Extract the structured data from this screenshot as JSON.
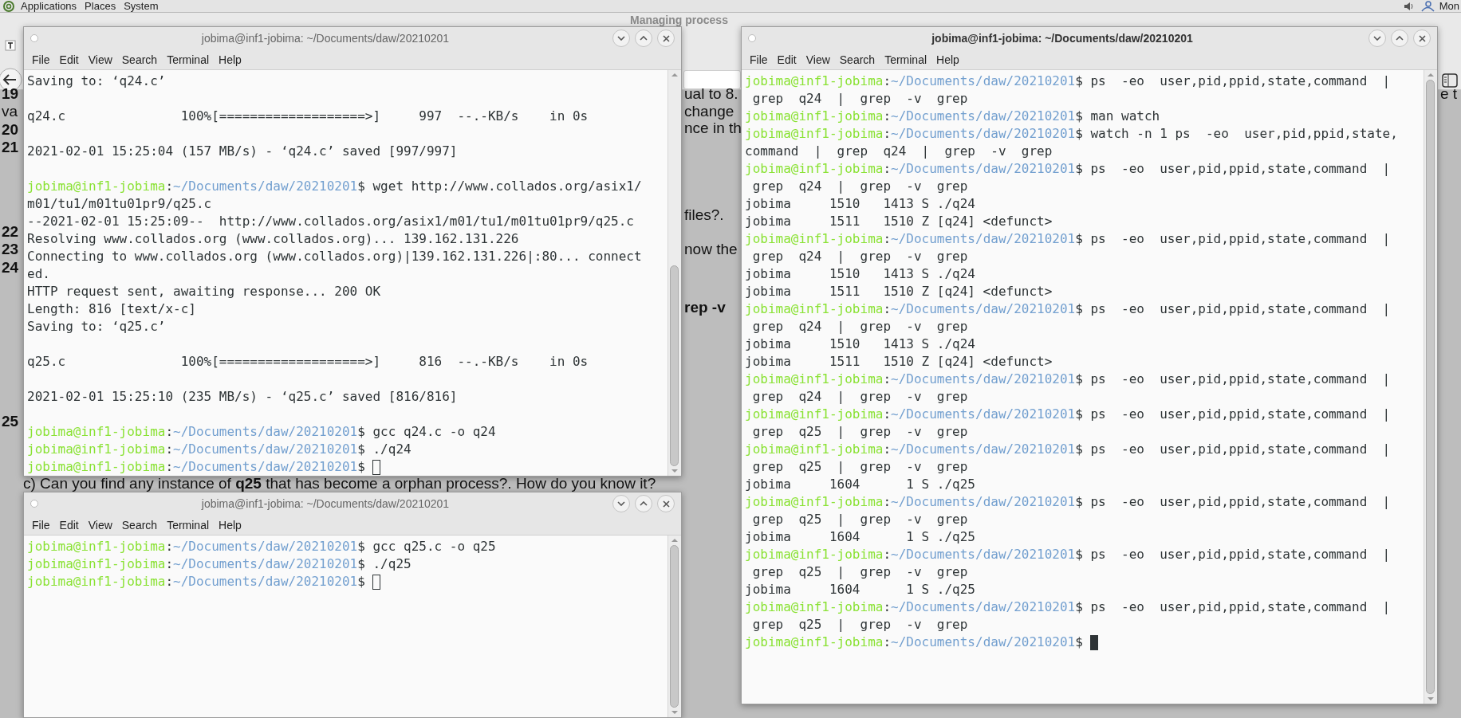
{
  "panel": {
    "menus": [
      "Applications",
      "Places",
      "System"
    ],
    "clock": "Mon"
  },
  "background_page": {
    "title": "Managing process",
    "fragments": [
      {
        "text": "19",
        "bold": true
      },
      {
        "text": "va",
        "bold": false
      },
      {
        "text": "20",
        "bold": true
      },
      {
        "text": "21",
        "bold": true
      },
      {
        "text": "22",
        "bold": true
      },
      {
        "text": "23",
        "bold": true
      },
      {
        "text": "24",
        "bold": true
      },
      {
        "text": "25",
        "bold": true
      },
      {
        "text": "ual to 8.",
        "bold": false
      },
      {
        "text": "change",
        "bold": false
      },
      {
        "text": "nce in th",
        "bold": false
      },
      {
        "text": "files?.",
        "bold": false
      },
      {
        "text": "now the",
        "bold": false
      },
      {
        "text": "rep  -v",
        "bold": true
      },
      {
        "text": "e t",
        "bold": false
      },
      {
        "text": "c) Can you find any instance of **q25** that has become a orphan process?. How do you know it?",
        "bold": false
      }
    ]
  },
  "windows": [
    {
      "title": "jobima@inf1-jobima: ~/Documents/daw/20210201",
      "focused": false,
      "menu": [
        "File",
        "Edit",
        "View",
        "Search",
        "Terminal",
        "Help"
      ],
      "lines": [
        {
          "kind": "output",
          "text": "Saving to: ‘q24.c’"
        },
        {
          "kind": "blank"
        },
        {
          "kind": "output",
          "text": "q24.c               100%[===================>]     997  --.-KB/s    in 0s"
        },
        {
          "kind": "blank"
        },
        {
          "kind": "output",
          "text": "2021-02-01 15:25:04 (157 MB/s) - ‘q24.c’ saved [997/997]"
        },
        {
          "kind": "blank"
        },
        {
          "kind": "prompt",
          "user": "jobima@inf1-jobima",
          "sep": ":",
          "path": "~/Documents/daw/20210201",
          "command": "$ wget http://www.collados.org/asix1/"
        },
        {
          "kind": "output",
          "text": "m01/tu1/m01tu01pr9/q25.c"
        },
        {
          "kind": "output",
          "text": "--2021-02-01 15:25:09--  http://www.collados.org/asix1/m01/tu1/m01tu01pr9/q25.c"
        },
        {
          "kind": "output",
          "text": "Resolving www.collados.org (www.collados.org)... 139.162.131.226"
        },
        {
          "kind": "output",
          "text": "Connecting to www.collados.org (www.collados.org)|139.162.131.226|:80... connect"
        },
        {
          "kind": "output",
          "text": "ed."
        },
        {
          "kind": "output",
          "text": "HTTP request sent, awaiting response... 200 OK"
        },
        {
          "kind": "output",
          "text": "Length: 816 [text/x-c]"
        },
        {
          "kind": "output",
          "text": "Saving to: ‘q25.c’"
        },
        {
          "kind": "blank"
        },
        {
          "kind": "output",
          "text": "q25.c               100%[===================>]     816  --.-KB/s    in 0s"
        },
        {
          "kind": "blank"
        },
        {
          "kind": "output",
          "text": "2021-02-01 15:25:10 (235 MB/s) - ‘q25.c’ saved [816/816]"
        },
        {
          "kind": "blank"
        },
        {
          "kind": "prompt",
          "user": "jobima@inf1-jobima",
          "sep": ":",
          "path": "~/Documents/daw/20210201",
          "command": "$ gcc q24.c -o q24"
        },
        {
          "kind": "prompt",
          "user": "jobima@inf1-jobima",
          "sep": ":",
          "path": "~/Documents/daw/20210201",
          "command": "$ ./q24"
        },
        {
          "kind": "prompt",
          "user": "jobima@inf1-jobima",
          "sep": ":",
          "path": "~/Documents/daw/20210201",
          "command": "$ ",
          "cursor": true
        }
      ]
    },
    {
      "title": "jobima@inf1-jobima: ~/Documents/daw/20210201",
      "focused": false,
      "menu": [
        "File",
        "Edit",
        "View",
        "Search",
        "Terminal",
        "Help"
      ],
      "lines": [
        {
          "kind": "prompt",
          "user": "jobima@inf1-jobima",
          "sep": ":",
          "path": "~/Documents/daw/20210201",
          "command": "$ gcc q25.c -o q25"
        },
        {
          "kind": "prompt",
          "user": "jobima@inf1-jobima",
          "sep": ":",
          "path": "~/Documents/daw/20210201",
          "command": "$ ./q25"
        },
        {
          "kind": "prompt",
          "user": "jobima@inf1-jobima",
          "sep": ":",
          "path": "~/Documents/daw/20210201",
          "command": "$ ",
          "cursor": true
        }
      ]
    },
    {
      "title": "jobima@inf1-jobima: ~/Documents/daw/20210201",
      "focused": true,
      "menu": [
        "File",
        "Edit",
        "View",
        "Search",
        "Terminal",
        "Help"
      ],
      "lines": [
        {
          "kind": "prompt",
          "user": "jobima@inf1-jobima",
          "sep": ":",
          "path": "~/Documents/daw/20210201",
          "command": "$ ps  -eo  user,pid,ppid,state,command  |"
        },
        {
          "kind": "output",
          "text": " grep  q24  |  grep  -v  grep"
        },
        {
          "kind": "prompt",
          "user": "jobima@inf1-jobima",
          "sep": ":",
          "path": "~/Documents/daw/20210201",
          "command": "$ man watch"
        },
        {
          "kind": "prompt",
          "user": "jobima@inf1-jobima",
          "sep": ":",
          "path": "~/Documents/daw/20210201",
          "command": "$ watch -n 1 ps  -eo  user,pid,ppid,state,"
        },
        {
          "kind": "output",
          "text": "command  |  grep  q24  |  grep  -v  grep"
        },
        {
          "kind": "prompt",
          "user": "jobima@inf1-jobima",
          "sep": ":",
          "path": "~/Documents/daw/20210201",
          "command": "$ ps  -eo  user,pid,ppid,state,command  |"
        },
        {
          "kind": "output",
          "text": " grep  q24  |  grep  -v  grep"
        },
        {
          "kind": "output",
          "text": "jobima     1510   1413 S ./q24"
        },
        {
          "kind": "output",
          "text": "jobima     1511   1510 Z [q24] <defunct>"
        },
        {
          "kind": "prompt",
          "user": "jobima@inf1-jobima",
          "sep": ":",
          "path": "~/Documents/daw/20210201",
          "command": "$ ps  -eo  user,pid,ppid,state,command  |"
        },
        {
          "kind": "output",
          "text": " grep  q24  |  grep  -v  grep"
        },
        {
          "kind": "output",
          "text": "jobima     1510   1413 S ./q24"
        },
        {
          "kind": "output",
          "text": "jobima     1511   1510 Z [q24] <defunct>"
        },
        {
          "kind": "prompt",
          "user": "jobima@inf1-jobima",
          "sep": ":",
          "path": "~/Documents/daw/20210201",
          "command": "$ ps  -eo  user,pid,ppid,state,command  |"
        },
        {
          "kind": "output",
          "text": " grep  q24  |  grep  -v  grep"
        },
        {
          "kind": "output",
          "text": "jobima     1510   1413 S ./q24"
        },
        {
          "kind": "output",
          "text": "jobima     1511   1510 Z [q24] <defunct>"
        },
        {
          "kind": "prompt",
          "user": "jobima@inf1-jobima",
          "sep": ":",
          "path": "~/Documents/daw/20210201",
          "command": "$ ps  -eo  user,pid,ppid,state,command  |"
        },
        {
          "kind": "output",
          "text": " grep  q24  |  grep  -v  grep"
        },
        {
          "kind": "prompt",
          "user": "jobima@inf1-jobima",
          "sep": ":",
          "path": "~/Documents/daw/20210201",
          "command": "$ ps  -eo  user,pid,ppid,state,command  |"
        },
        {
          "kind": "output",
          "text": " grep  q25  |  grep  -v  grep"
        },
        {
          "kind": "prompt",
          "user": "jobima@inf1-jobima",
          "sep": ":",
          "path": "~/Documents/daw/20210201",
          "command": "$ ps  -eo  user,pid,ppid,state,command  |"
        },
        {
          "kind": "output",
          "text": " grep  q25  |  grep  -v  grep"
        },
        {
          "kind": "output",
          "text": "jobima     1604      1 S ./q25"
        },
        {
          "kind": "prompt",
          "user": "jobima@inf1-jobima",
          "sep": ":",
          "path": "~/Documents/daw/20210201",
          "command": "$ ps  -eo  user,pid,ppid,state,command  |"
        },
        {
          "kind": "output",
          "text": " grep  q25  |  grep  -v  grep"
        },
        {
          "kind": "output",
          "text": "jobima     1604      1 S ./q25"
        },
        {
          "kind": "prompt",
          "user": "jobima@inf1-jobima",
          "sep": ":",
          "path": "~/Documents/daw/20210201",
          "command": "$ ps  -eo  user,pid,ppid,state,command  |"
        },
        {
          "kind": "output",
          "text": " grep  q25  |  grep  -v  grep"
        },
        {
          "kind": "output",
          "text": "jobima     1604      1 S ./q25"
        },
        {
          "kind": "prompt",
          "user": "jobima@inf1-jobima",
          "sep": ":",
          "path": "~/Documents/daw/20210201",
          "command": "$ ps  -eo  user,pid,ppid,state,command  |"
        },
        {
          "kind": "output",
          "text": " grep  q25  |  grep  -v  grep"
        },
        {
          "kind": "prompt",
          "user": "jobima@inf1-jobima",
          "sep": ":",
          "path": "~/Documents/daw/20210201",
          "command": "$ ",
          "cursor": true
        }
      ]
    }
  ]
}
